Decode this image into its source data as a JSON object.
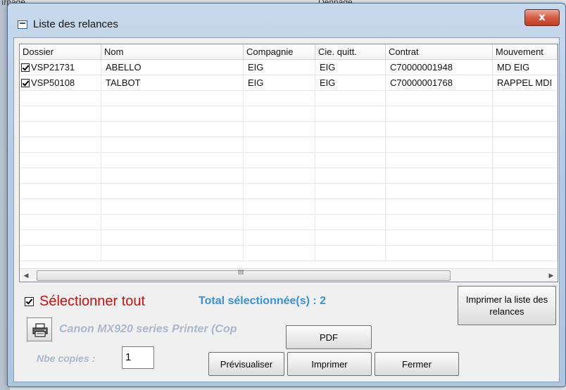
{
  "background": {
    "fragment_left": "ırpage",
    "fragment_right": "Dennage"
  },
  "window": {
    "title": "Liste des relances",
    "close_label": "x"
  },
  "grid": {
    "columns": [
      "Dossier",
      "Nom",
      "Compagnie",
      "Cie. quitt.",
      "Contrat",
      "Mouvement"
    ],
    "rows": [
      {
        "checked": true,
        "cells": [
          "VSP21731",
          "ABELLO",
          "EIG",
          "EIG",
          "C70000001948",
          "MD EIG"
        ]
      },
      {
        "checked": true,
        "cells": [
          "VSP50108",
          "TALBOT",
          "EIG",
          "EIG",
          "C70000001768",
          "RAPPEL MDI"
        ]
      }
    ],
    "empty_rows": 11,
    "scrollbar": {
      "left_arrow": "◀",
      "right_arrow": "▶",
      "grip": "III"
    }
  },
  "select_all": {
    "label": "Sélectionner tout",
    "checked": true
  },
  "total_label": "Total sélectionnée(s) : 2",
  "buttons": {
    "print_list": "Imprimer la liste des relances",
    "pdf": "PDF",
    "preview": "Prévisualiser",
    "print": "Imprimer",
    "close": "Fermer"
  },
  "printer": {
    "icon": "printer-icon",
    "name": "Canon MX920 series Printer (Cop"
  },
  "copies": {
    "label": "Nbe copies :",
    "value": "1"
  }
}
